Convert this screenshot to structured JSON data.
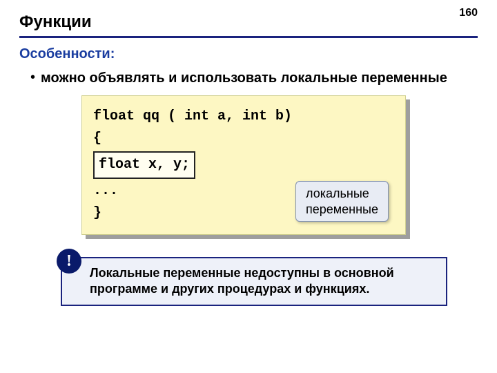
{
  "page_number": "160",
  "title": "Функции",
  "subtitle": "Особенности:",
  "bullet": "можно объявлять и использовать локальные переменные",
  "code": {
    "line1": "float qq ( int a, int b)",
    "line2": "{",
    "inner": "float x, y;",
    "line3": "...",
    "line4": "}"
  },
  "callout": {
    "line1": "локальные",
    "line2": "переменные"
  },
  "note": {
    "badge": "!",
    "text": "Локальные переменные недоступны в основной программе и других процедурах и функциях."
  }
}
